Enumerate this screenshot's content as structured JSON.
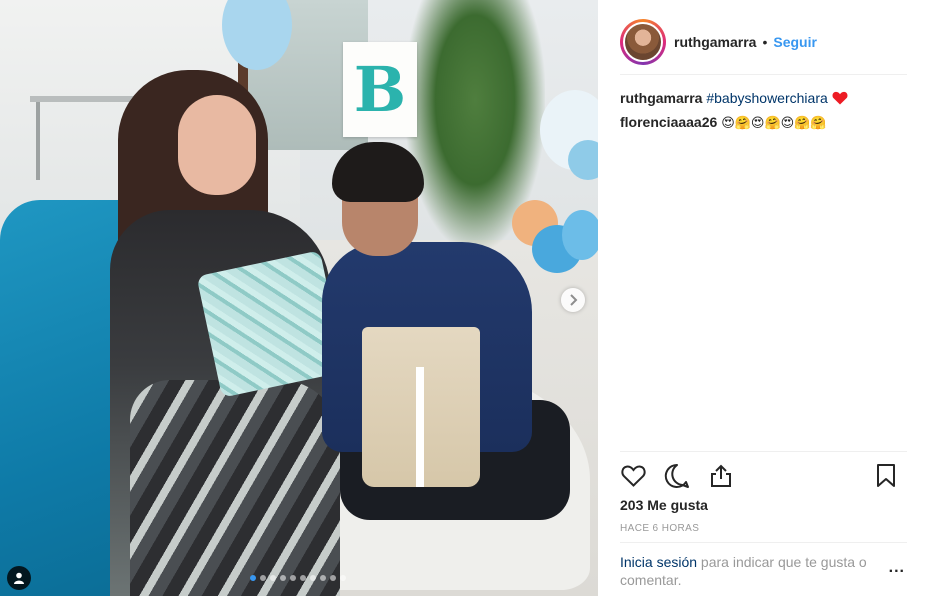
{
  "post": {
    "username": "ruthgamarra",
    "separator": "•",
    "follow_label": "Seguir"
  },
  "comments": [
    {
      "user": "ruthgamarra",
      "hashtag": "#babyshowerchiara",
      "emoji": "❤️"
    },
    {
      "user": "florenciaaaa26",
      "emoji": "😍🤗😍🤗😍🤗🤗"
    }
  ],
  "photo": {
    "sign_letter": "B",
    "carousel_dots": 10,
    "active_dot": 0
  },
  "actions": {
    "like_icon": "heart-icon",
    "comment_icon": "comment-icon",
    "share_icon": "share-icon",
    "save_icon": "bookmark-icon"
  },
  "likes_text": "203 Me gusta",
  "time_text": "HACE 6 HORAS",
  "login": {
    "link": "Inicia sesión",
    "rest": " para indicar que te gusta o comentar.",
    "more": "..."
  },
  "colors": {
    "link": "#3897f0",
    "hashtag": "#003569",
    "heart": "#ed4956"
  }
}
